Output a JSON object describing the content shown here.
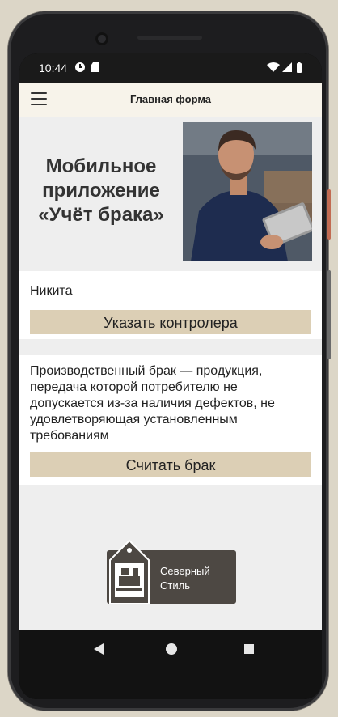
{
  "status_bar": {
    "time": "10:44",
    "left_icons": [
      "google-play-protect-icon",
      "sd-card-icon"
    ],
    "right_icons": [
      "wifi-icon",
      "signal-icon",
      "battery-icon"
    ]
  },
  "toolbar": {
    "title": "Главная форма",
    "menu_icon": "hamburger-menu-icon"
  },
  "hero": {
    "title_line1": "Мобильное",
    "title_line2": "приложение",
    "title_line3": "«Учёт брака»",
    "photo": "worker-with-tablet-photo"
  },
  "controller_section": {
    "name": "Никита",
    "button_label": "Указать контролера"
  },
  "defect_section": {
    "description": "Производственный брак — продукция, передача которой потребителю не допускается из-за наличия дефектов, не удовлетворяющая установленным требованиям",
    "button_label": "Считать брак"
  },
  "logo": {
    "line1": "Северный",
    "line2": "Стиль"
  },
  "colors": {
    "toolbar_bg": "#f7f3ea",
    "button_bg": "#dccfb5",
    "app_bg": "#eeeeee",
    "logo_bg": "#4d4843"
  },
  "nav_bar": {
    "back": "back-triangle-icon",
    "home": "home-circle-icon",
    "recents": "recents-square-icon"
  }
}
